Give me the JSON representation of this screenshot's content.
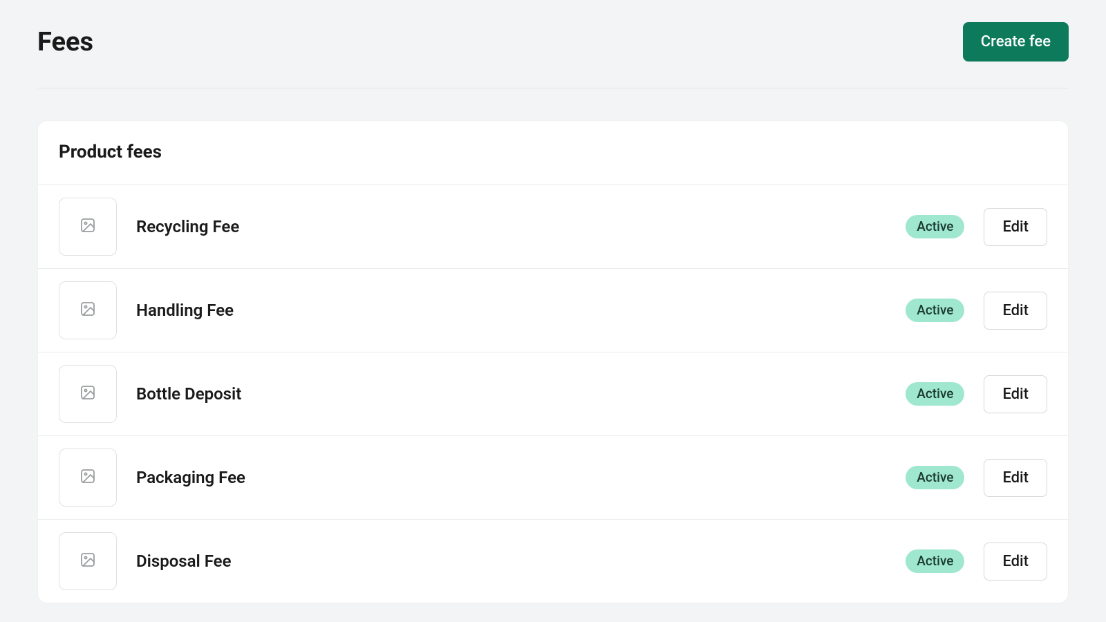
{
  "header": {
    "title": "Fees",
    "create_label": "Create fee"
  },
  "section": {
    "title": "Product fees"
  },
  "fees": [
    {
      "name": "Recycling Fee",
      "status": "Active",
      "edit": "Edit"
    },
    {
      "name": "Handling Fee",
      "status": "Active",
      "edit": "Edit"
    },
    {
      "name": "Bottle Deposit",
      "status": "Active",
      "edit": "Edit"
    },
    {
      "name": "Packaging Fee",
      "status": "Active",
      "edit": "Edit"
    },
    {
      "name": "Disposal Fee",
      "status": "Active",
      "edit": "Edit"
    }
  ],
  "colors": {
    "accent": "#0c7a5b",
    "badge_bg": "#a0e7d0"
  }
}
